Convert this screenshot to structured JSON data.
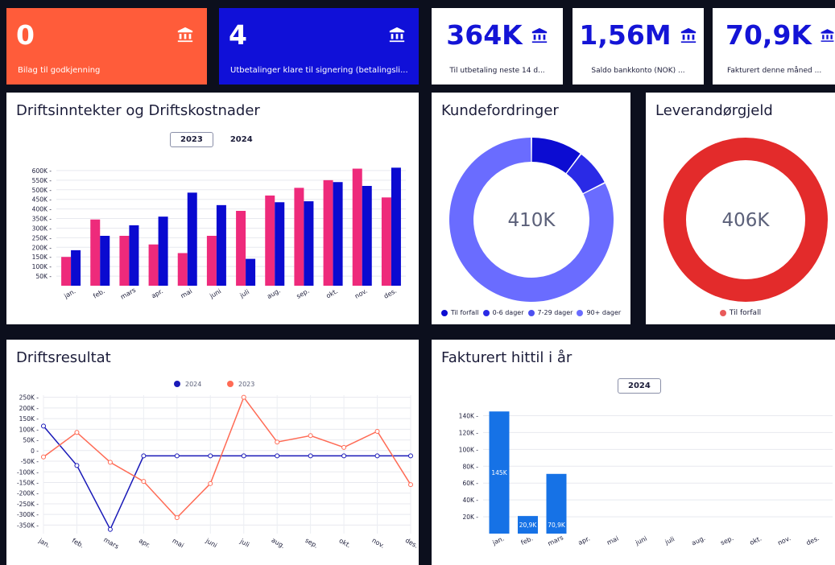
{
  "colors": {
    "orange": "#ff5c3a",
    "blue_dark": "#1010d8",
    "pink": "#ee2a7b",
    "navy_bar": "#0a0ad0",
    "light_purple": "#6a6cff",
    "red": "#e32b2b",
    "line_orange": "#ff6b55",
    "line_blue": "#1a1ab8",
    "fakt_blue": "#1672e6"
  },
  "kpis": [
    {
      "value": "0",
      "label": "Bilag til godkjenning",
      "icon": "bank-icon"
    },
    {
      "value": "4",
      "label": "Utbetalinger klare til signering (betalingsli...",
      "icon": "bank-icon"
    },
    {
      "value": "364K",
      "label": "Til utbetaling neste 14 d...",
      "icon": "bank-icon"
    },
    {
      "value": "1,56M",
      "label": "Saldo bankkonto (NOK) ...",
      "icon": "bank-icon"
    },
    {
      "value": "70,9K",
      "label": "Fakturert denne måned ...",
      "icon": "bank-icon"
    }
  ],
  "drifts_title": "Driftsinntekter og Driftskostnader",
  "drifts_years": [
    "2023",
    "2024"
  ],
  "kunde": {
    "title": "Kundefordringer",
    "center": "410K"
  },
  "lev": {
    "title": "Leverandørgjeld",
    "center": "406K",
    "legend": "Til forfall"
  },
  "resultat": {
    "title": "Driftsresultat",
    "legend": [
      "2024",
      "2023"
    ]
  },
  "fakturert": {
    "title": "Fakturert hittil i år",
    "year": "2024"
  },
  "chart_data": [
    {
      "type": "bar",
      "title": "Driftsinntekter og Driftskostnader",
      "categories": [
        "jan.",
        "feb.",
        "mars",
        "apr.",
        "mai",
        "juni",
        "juli",
        "aug.",
        "sep.",
        "okt.",
        "nov.",
        "des."
      ],
      "series": [
        {
          "values": [
            150000,
            345000,
            260000,
            215000,
            170000,
            260000,
            390000,
            470000,
            510000,
            550000,
            610000,
            460000
          ]
        },
        {
          "values": [
            185000,
            260000,
            315000,
            360000,
            485000,
            420000,
            140000,
            435000,
            440000,
            540000,
            520000,
            615000
          ]
        }
      ],
      "yticks": [
        "50K",
        "100K",
        "150K",
        "200K",
        "250K",
        "300K",
        "350K",
        "400K",
        "450K",
        "500K",
        "550K",
        "600K"
      ],
      "ylim": [
        0,
        650000
      ]
    },
    {
      "type": "pie",
      "title": "Kundefordringer",
      "labels": [
        "Til forfall",
        "0-6 dager",
        "7-29 dager",
        "90+ dager"
      ],
      "values": [
        42,
        30,
        0,
        338
      ],
      "colors": [
        "#0c0cd2",
        "#2a2ae6",
        "#4d50f0",
        "#6a6cff"
      ]
    },
    {
      "type": "pie",
      "title": "Leverandørgjeld",
      "labels": [
        "Til forfall"
      ],
      "values": [
        406
      ],
      "colors": [
        "#e32b2b"
      ]
    },
    {
      "type": "line",
      "title": "Driftsresultat",
      "categories": [
        "jan.",
        "feb.",
        "mars",
        "apr.",
        "mai",
        "juni",
        "juli",
        "aug.",
        "sep.",
        "okt.",
        "nov.",
        "des."
      ],
      "series": [
        {
          "name": "2024",
          "values": [
            115000,
            -70000,
            -370000,
            -25000,
            -25000,
            -25000,
            -25000,
            -25000,
            -25000,
            -25000,
            -25000,
            -25000
          ]
        },
        {
          "name": "2023",
          "values": [
            -30000,
            85000,
            -55000,
            -145000,
            -315000,
            -155000,
            250000,
            40000,
            70000,
            15000,
            90000,
            -160000
          ]
        }
      ],
      "yticks": [
        "250K",
        "200K",
        "150K",
        "100K",
        "50K",
        "0",
        "-50K",
        "-100K",
        "-150K",
        "-200K",
        "-250K",
        "-300K",
        "-350K"
      ],
      "ylim": [
        -390000,
        260000
      ]
    },
    {
      "type": "bar",
      "title": "Fakturert hittil i år",
      "categories": [
        "jan.",
        "feb.",
        "mars",
        "apr.",
        "mai",
        "juni",
        "juli",
        "aug.",
        "sep.",
        "okt.",
        "nov.",
        "des."
      ],
      "values": [
        145000,
        20900,
        70900,
        0,
        0,
        0,
        0,
        0,
        0,
        0,
        0,
        0
      ],
      "data_labels": [
        "145K",
        "20,9K",
        "70,9K"
      ],
      "yticks": [
        "20K",
        "40K",
        "60K",
        "80K",
        "100K",
        "120K",
        "140K"
      ],
      "ylim": [
        0,
        150000
      ]
    }
  ]
}
